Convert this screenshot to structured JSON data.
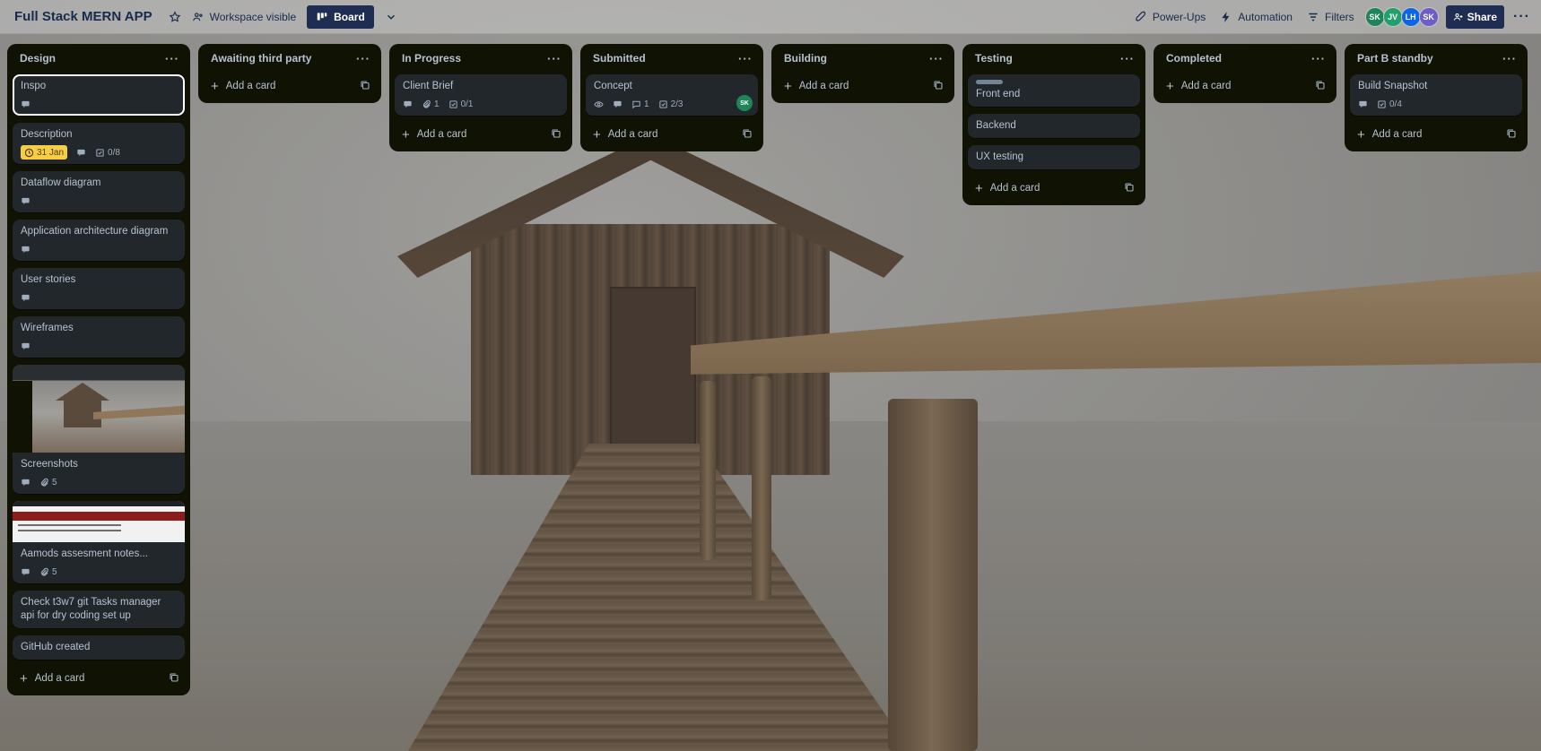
{
  "board": {
    "title": "Full Stack MERN APP",
    "visibility": "Workspace visible",
    "view": "Board"
  },
  "header_right": {
    "powerups": "Power-Ups",
    "automation": "Automation",
    "filters": "Filters",
    "share": "Share",
    "members": [
      {
        "initials": "SK",
        "color": "#1f845a"
      },
      {
        "initials": "JV",
        "color": "#22a06b"
      },
      {
        "initials": "LH",
        "color": "#0c66e4"
      },
      {
        "initials": "SK",
        "color": "#6e5dc6"
      }
    ]
  },
  "add_card_label": "Add a card",
  "lists": [
    {
      "title": "Design",
      "cards": [
        {
          "title": "Inspo",
          "selected": true,
          "badges": {
            "description": true
          }
        },
        {
          "title": "Description",
          "badges": {
            "due": "31 Jan",
            "description": true,
            "checklist": "0/8"
          }
        },
        {
          "title": "Dataflow diagram",
          "badges": {
            "description": true
          }
        },
        {
          "title": "Application architecture diagram",
          "badges": {
            "description": true
          }
        },
        {
          "title": "User stories",
          "badges": {
            "description": true
          }
        },
        {
          "title": "Wireframes",
          "badges": {
            "description": true
          }
        },
        {
          "title": "Screenshots",
          "cover": "scene",
          "badges": {
            "description": true,
            "attachments": "5"
          }
        },
        {
          "title": "Aamods assesment notes...",
          "cover": "doc",
          "badges": {
            "description": true,
            "attachments": "5"
          }
        },
        {
          "title": "Check t3w7 git Tasks manager api for dry coding set up"
        },
        {
          "title": "GitHub created"
        }
      ]
    },
    {
      "title": "Awaiting third party",
      "cards": []
    },
    {
      "title": "In Progress",
      "cards": [
        {
          "title": "Client Brief",
          "badges": {
            "description": true,
            "attachments": "1",
            "checklist": "0/1"
          }
        }
      ]
    },
    {
      "title": "Submitted",
      "cards": [
        {
          "title": "Concept",
          "member": "SK",
          "badges": {
            "watching": true,
            "description": true,
            "comments": "1",
            "checklist": "2/3"
          }
        }
      ]
    },
    {
      "title": "Building",
      "cards": []
    },
    {
      "title": "Testing",
      "cards": [
        {
          "title": "Front end",
          "label": true
        },
        {
          "title": "Backend"
        },
        {
          "title": "UX testing"
        }
      ]
    },
    {
      "title": "Completed",
      "cards": []
    },
    {
      "title": "Part B standby",
      "cards": [
        {
          "title": "Build Snapshot",
          "badges": {
            "description": true,
            "checklist": "0/4"
          }
        }
      ]
    }
  ]
}
